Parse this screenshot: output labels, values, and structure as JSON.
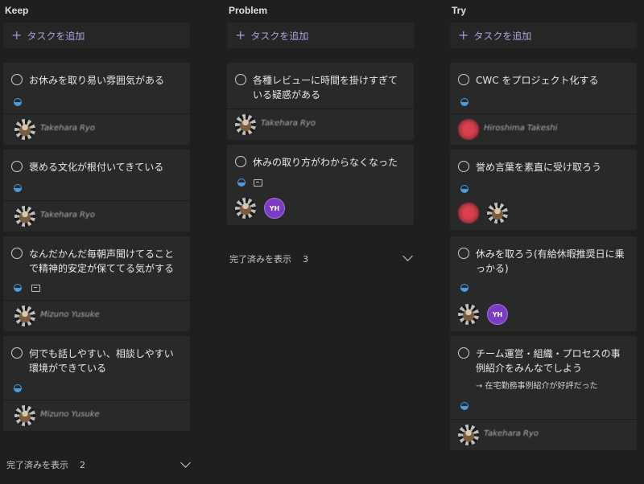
{
  "columns": [
    {
      "title": "Keep",
      "add_task": "タスクを追加",
      "cards": [
        {
          "title": "お休みを取り易い雰囲気がある",
          "assignee": "Takehara Ryo"
        },
        {
          "title": "褒める文化が根付いてきている",
          "assignee": "Takehara Ryo"
        },
        {
          "title": "なんだかんだ毎朝声聞けてることで精神的安定が保ててる気がする",
          "assignee": "Mizuno Yusuke"
        },
        {
          "title": "何でも話しやすい、相談しやすい環境ができている",
          "assignee": "Mizuno Yusuke"
        }
      ],
      "show_completed": "完了済みを表示",
      "completed_count": "2"
    },
    {
      "title": "Problem",
      "add_task": "タスクを追加",
      "cards": [
        {
          "title": "各種レビューに時間を掛けすぎている疑惑がある",
          "assignee": "Takehara Ryo"
        },
        {
          "title": "休みの取り方がわからなくなった",
          "initials": "YH"
        }
      ],
      "show_completed": "完了済みを表示",
      "completed_count": "3"
    },
    {
      "title": "Try",
      "add_task": "タスクを追加",
      "cards": [
        {
          "title": "CWC をプロジェクト化する",
          "assignee": "Hiroshima Takeshi"
        },
        {
          "title": "誉め言葉を素直に受け取ろう"
        },
        {
          "title": "休みを取ろう(有給休暇推奨日に乗っかる)",
          "initials": "YH"
        },
        {
          "title": "チーム運営・組織・プロセスの事例紹介をみんなでしよう",
          "note": "→ 在宅勤務事例紹介が好評だった",
          "assignee": "Takehara Ryo"
        }
      ]
    }
  ],
  "colors": {
    "background": "#1f1f1f",
    "card": "#292929",
    "accent": "#a9a4df",
    "progress": "#4b9be0"
  }
}
